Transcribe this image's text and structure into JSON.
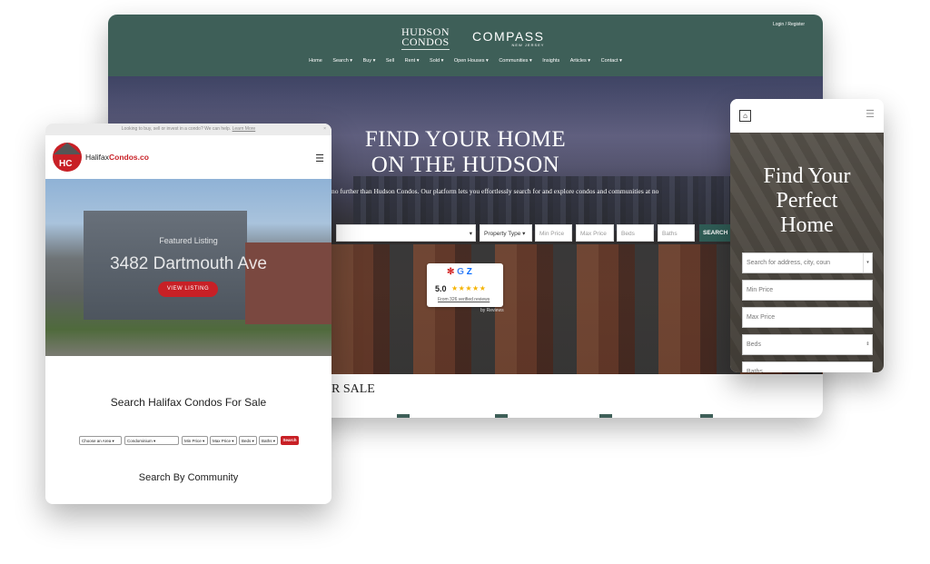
{
  "hudson": {
    "logo_main": "HUDSON",
    "logo_sub": "CONDOS",
    "partner_logo": "COMPASS",
    "partner_sub": "NEW JERSEY",
    "login": "Login / Register",
    "nav": [
      "Home",
      "Search ▾",
      "Buy ▾",
      "Sell",
      "Rent ▾",
      "Sold ▾",
      "Open Houses ▾",
      "Communities ▾",
      "Insights",
      "Articles ▾",
      "Contact ▾"
    ],
    "hero_line1": "FIND YOUR HOME",
    "hero_line2": "ON THE HUDSON",
    "hero_intro": "no further than Hudson Condos. Our platform lets you effortlessly search for and explore condos and communities at no",
    "search": {
      "location_arrow": "▾",
      "property_type": "Property Type ▾",
      "min_price": "Min Price",
      "max_price": "Max Price",
      "beds": "Beds",
      "baths": "Baths",
      "button": "SEARCH"
    },
    "reviews": {
      "rating": "5.0",
      "stars": "★★★★★",
      "count_text": "From 326 verified reviews",
      "byline": "by Reviews"
    },
    "section_title": "R SALE"
  },
  "halifax": {
    "topbar_text": "Looking to buy, sell or invest in a condo? We can help.",
    "topbar_link": "Learn More",
    "close": "×",
    "logo_letters": "HC",
    "brand_part1": "Halifax",
    "brand_part2": "Condos",
    "brand_part3": ".co",
    "menu": "☰",
    "featured": "Featured Listing",
    "address": "3482 Dartmouth Ave",
    "view_button": "VIEW LISTING",
    "search_title": "Search Halifax Condos For Sale",
    "filters": {
      "area": "Choose an Area ▾",
      "type": "Condominium ▾",
      "min": "Min Price ▾",
      "max": "Max Price ▾",
      "beds": "Beds ▾",
      "baths": "Baths ▾",
      "button": "Search"
    },
    "community_title": "Search By Community"
  },
  "mobile": {
    "menu": "☰",
    "logo_icon": "⌂",
    "hero_line1": "Find Your",
    "hero_line2": "Perfect",
    "hero_line3": "Home",
    "search_placeholder": "Search for address, city, coun",
    "search_arrow": "▾",
    "min_price": "Min Price",
    "max_price": "Max Price",
    "beds": "Beds",
    "beds_stepper": "⇕",
    "baths": "Baths"
  }
}
